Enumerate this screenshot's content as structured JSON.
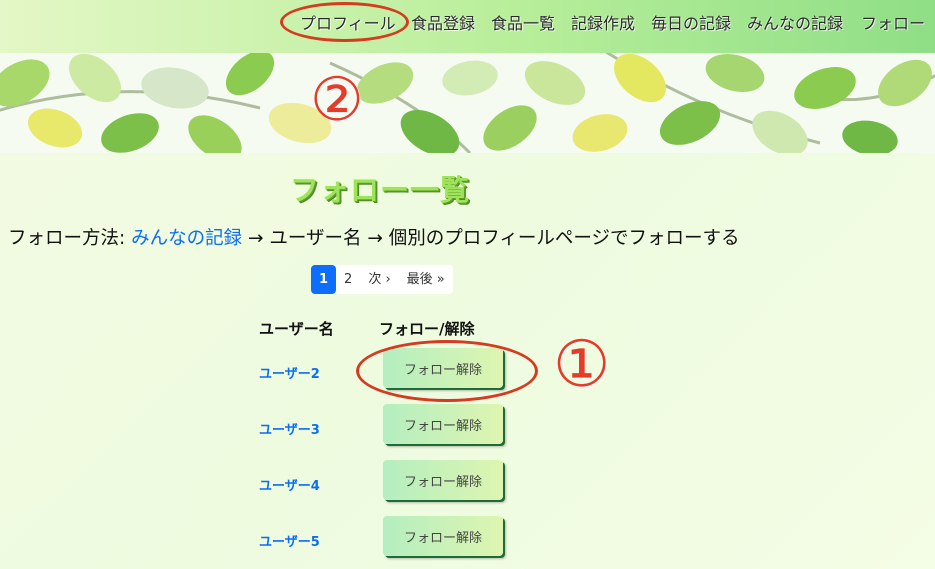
{
  "nav": {
    "items": [
      "プロフィール",
      "食品登録",
      "食品一覧",
      "記録作成",
      "毎日の記録",
      "みんなの記録",
      "フォロー"
    ]
  },
  "annotations": {
    "marker_1": "①",
    "marker_2": "②"
  },
  "page": {
    "title": "フォロー一覧",
    "howto_prefix": "フォロー方法: ",
    "howto_link": "みんなの記録",
    "howto_suffix": " → ユーザー名 → 個別のプロフィールページでフォローする"
  },
  "pagination": {
    "pages": [
      "1",
      "2"
    ],
    "next": "次 ›",
    "last": "最後 »",
    "current": "1"
  },
  "table": {
    "headers": [
      "ユーザー名",
      "フォロー/解除"
    ],
    "rows": [
      {
        "user": "ユーザー2",
        "action": "フォロー解除"
      },
      {
        "user": "ユーザー3",
        "action": "フォロー解除"
      },
      {
        "user": "ユーザー4",
        "action": "フォロー解除"
      },
      {
        "user": "ユーザー5",
        "action": "フォロー解除"
      }
    ]
  },
  "colors": {
    "accent_link": "#0b6ff5",
    "annotation_red": "#d63a1f",
    "active_page": "#0d6efd"
  }
}
